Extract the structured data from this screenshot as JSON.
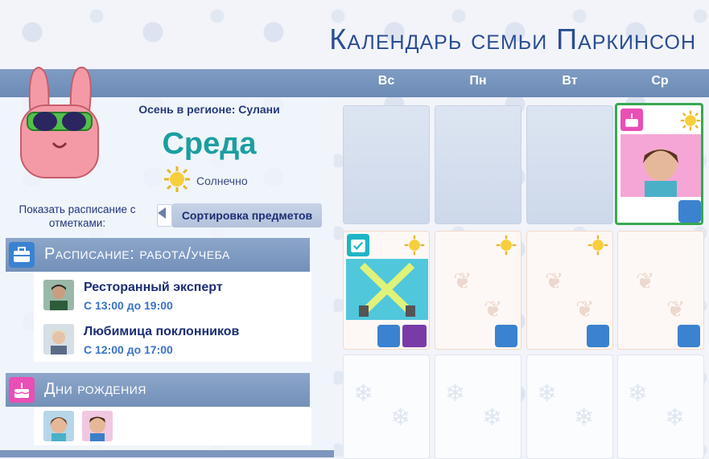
{
  "title": "Календарь семьи Паркинсон",
  "days": [
    "Вс",
    "Пн",
    "Вт",
    "Ср"
  ],
  "today": {
    "season": "Осень в регионе: Сулани",
    "day": "Среда",
    "weather": "Солнечно"
  },
  "schedule_filter": {
    "label": "Показать расписание с отметками:",
    "sort_button": "Сортировка предметов"
  },
  "work_section": {
    "title": "Расписание: работа/учеба",
    "items": [
      {
        "title": "Ресторанный эксперт",
        "time": "С 13:00 до 19:00"
      },
      {
        "title": "Любимица поклонников",
        "time": "С 12:00 до 17:00"
      }
    ]
  },
  "birthdays_section": {
    "title": "Дни рождения"
  },
  "colors": {
    "accent": "#2a4d94",
    "today_border": "#38a850",
    "day_name": "#1b9ea1",
    "briefcase": "#3b82d0",
    "birthday_pink": "#e94fb5"
  }
}
